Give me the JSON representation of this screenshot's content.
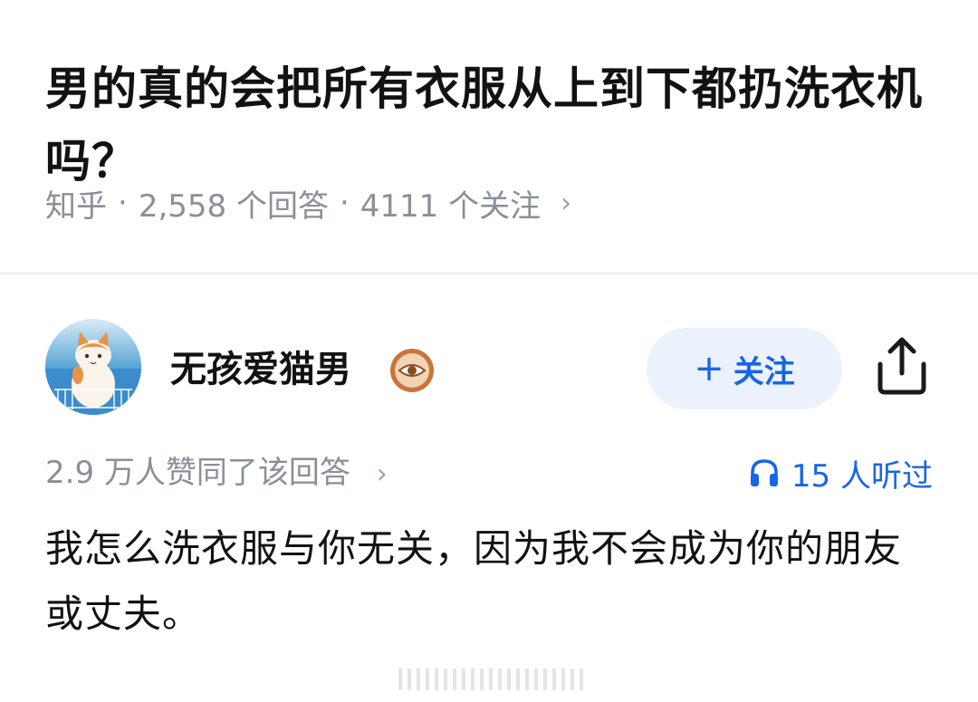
{
  "question": {
    "title": "男的真的会把所有衣服从上到下都扔洗衣机吗？",
    "source": "知乎",
    "separator": "·",
    "answers_count": "2,558 个回答",
    "followers_count": "4111 个关注",
    "chevron": "›"
  },
  "answer": {
    "author": {
      "name": "无孩爱猫男",
      "avatar_icon": "cat-avatar-icon",
      "badge_icon": "eye-badge-icon"
    },
    "follow_button": {
      "plus": "+",
      "label": "关注"
    },
    "share_icon": "share-icon",
    "upvotes_text": "2.9 万人赞同了该回答",
    "upvotes_chevron": "›",
    "listened": {
      "icon": "headphones-icon",
      "text": "15 人听过"
    },
    "content": "我怎么洗衣服与你无关，因为我不会成为你的朋友或丈夫。"
  },
  "colors": {
    "accent": "#1766e5",
    "follow_bg": "#ebf2fd",
    "muted_text": "#8a8f99",
    "badge": "#c8743a"
  }
}
